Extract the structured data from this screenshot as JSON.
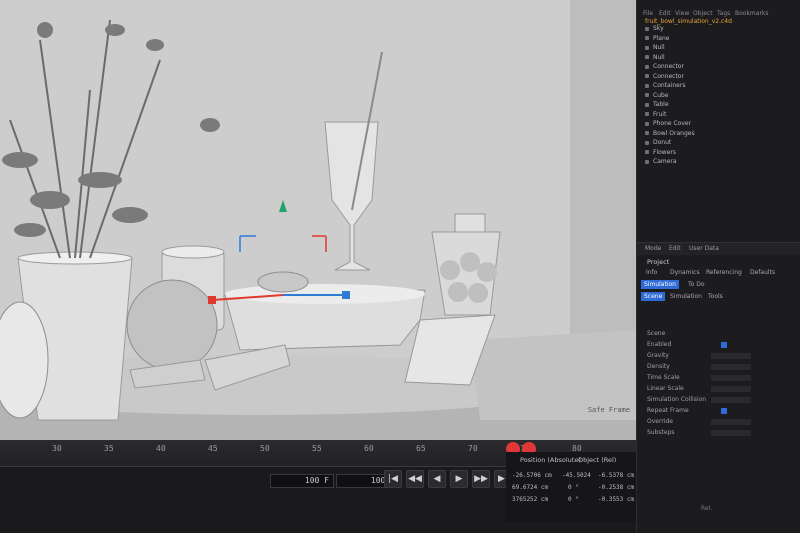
{
  "viewport": {
    "status_label": "Safe Frame"
  },
  "timeline": {
    "ticks": [
      "30",
      "35",
      "40",
      "45",
      "50",
      "55",
      "60",
      "65",
      "70",
      "75",
      "80"
    ],
    "start_frame": "100 F",
    "end_frame": "100 F"
  },
  "transport": {
    "buttons": [
      "|◀",
      "◀◀",
      "◀",
      "▶",
      "▶▶",
      "▶|",
      "↻"
    ]
  },
  "coords": {
    "header_position": "Position (Absolute)",
    "header_rotation": "Object (Rel)",
    "rows": [
      {
        "x": "-26.5706 cm",
        "y": "-45.5024",
        "z": "-6.5378 cm"
      },
      {
        "x": "69.6724 cm",
        "y": "0 °",
        "z": "-0.2538 cm"
      },
      {
        "x": "3765252 cm",
        "y": "0 °",
        "z": "-0.3553 cm"
      }
    ]
  },
  "panel": {
    "menu_items": [
      "File",
      "Edit",
      "View",
      "Object",
      "Tags",
      "Bookmarks"
    ],
    "scene_file": "fruit_bowl_simulation_v2.c4d",
    "objects": [
      {
        "name": "Sky",
        "selected": false
      },
      {
        "name": "Plane",
        "selected": false
      },
      {
        "name": "Null",
        "selected": false
      },
      {
        "name": "Null",
        "selected": false
      },
      {
        "name": "Connector",
        "selected": false
      },
      {
        "name": "Connector",
        "selected": false
      },
      {
        "name": "Containers",
        "selected": false
      },
      {
        "name": "Cube",
        "selected": false
      },
      {
        "name": "Table",
        "selected": false
      },
      {
        "name": "Fruit",
        "selected": false
      },
      {
        "name": "Phone Cover",
        "selected": false
      },
      {
        "name": "Bowl Oranges",
        "selected": false
      },
      {
        "name": "Donut",
        "selected": false
      },
      {
        "name": "Flowers",
        "selected": false
      },
      {
        "name": "Camera",
        "selected": false
      }
    ],
    "attr_header": [
      "Mode",
      "Edit",
      "User Data"
    ],
    "attr_title": "Project",
    "tabs": [
      "Info",
      "Dynamics",
      "Referencing",
      "Defaults",
      "Simulation",
      "To Do",
      "Scene",
      "Simulation",
      "Tools"
    ],
    "active_tab": "Scene",
    "attributes": [
      {
        "label": "Scene",
        "value": ""
      },
      {
        "label": "Enabled",
        "value": ""
      },
      {
        "label": "Gravity",
        "value": ""
      },
      {
        "label": "Density",
        "value": ""
      },
      {
        "label": "Time Scale",
        "value": ""
      },
      {
        "label": "Linear Scale",
        "value": ""
      },
      {
        "label": "Simulation Collision",
        "value": ""
      },
      {
        "label": "Repeat Frame",
        "value": ""
      },
      {
        "label": "Override",
        "value": ""
      },
      {
        "label": "Substeps",
        "value": ""
      }
    ],
    "bottom_status": "Rel."
  }
}
